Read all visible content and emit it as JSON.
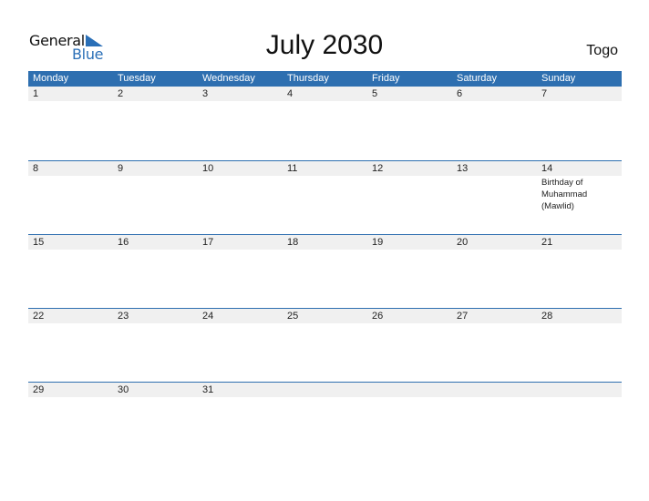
{
  "logo": {
    "line1": "General",
    "line2": "Blue"
  },
  "title": "July 2030",
  "country": "Togo",
  "colors": {
    "accent": "#2e6fb0",
    "row_bg": "#f0f0f0"
  },
  "weekdays": [
    "Monday",
    "Tuesday",
    "Wednesday",
    "Thursday",
    "Friday",
    "Saturday",
    "Sunday"
  ],
  "weeks": [
    {
      "days": [
        "1",
        "2",
        "3",
        "4",
        "5",
        "6",
        "7"
      ],
      "events": [
        "",
        "",
        "",
        "",
        "",
        "",
        ""
      ]
    },
    {
      "days": [
        "8",
        "9",
        "10",
        "11",
        "12",
        "13",
        "14"
      ],
      "events": [
        "",
        "",
        "",
        "",
        "",
        "",
        "Birthday of Muhammad (Mawlid)"
      ]
    },
    {
      "days": [
        "15",
        "16",
        "17",
        "18",
        "19",
        "20",
        "21"
      ],
      "events": [
        "",
        "",
        "",
        "",
        "",
        "",
        ""
      ]
    },
    {
      "days": [
        "22",
        "23",
        "24",
        "25",
        "26",
        "27",
        "28"
      ],
      "events": [
        "",
        "",
        "",
        "",
        "",
        "",
        ""
      ]
    },
    {
      "days": [
        "29",
        "30",
        "31",
        "",
        "",
        "",
        ""
      ],
      "events": [
        "",
        "",
        "",
        "",
        "",
        "",
        ""
      ]
    }
  ]
}
